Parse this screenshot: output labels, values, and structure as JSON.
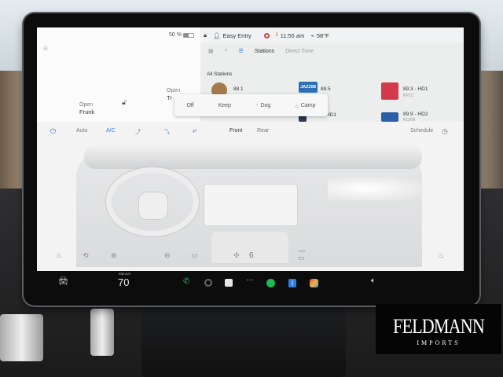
{
  "status_bar": {
    "battery": "50 %",
    "battery_level": 0.5,
    "profile": "Easy Entry",
    "time": "11:55 am",
    "temperature": "58°F",
    "recording_color": "#d44444"
  },
  "trunk_card": {
    "frunk_state": "Open",
    "frunk_label": "Frunk",
    "trunk_state": "Open",
    "trunk_label": "Tr"
  },
  "media": {
    "tabs": [
      "Stations",
      "Direct Tune"
    ],
    "section_title": "All Stations",
    "stations": [
      {
        "name": "88.1",
        "sub": "",
        "logo_color": "#a57a4a"
      },
      {
        "name": "88.5",
        "sub": "",
        "logo_color": "#2c6fb7"
      },
      {
        "name": "89.3 - HD1",
        "sub": "KPCC",
        "logo_color": "#d33a4b"
      },
      {
        "name": "HD1",
        "sub": "",
        "logo_color": "#2d3a55"
      },
      {
        "name": "89.9 - HD2",
        "sub": "KCRW",
        "logo_color": "#2c5fa8"
      }
    ],
    "jazz_logo": "JAZZ88"
  },
  "climate_modes": [
    "Off",
    "Keep",
    "Dog",
    "Camp"
  ],
  "climate": {
    "auto": "Auto",
    "ac": "A/C",
    "front": "Front",
    "rear": "Rear",
    "schedule": "Schedule",
    "fan_speed": "6",
    "auto_small": "Auto",
    "accent": "#2e7be6"
  },
  "dock": {
    "temp_label": "Manual",
    "temp_value": "70",
    "dots": "···"
  },
  "watermark": {
    "line1": "FELDMANN",
    "line2": "IMPORTS"
  }
}
